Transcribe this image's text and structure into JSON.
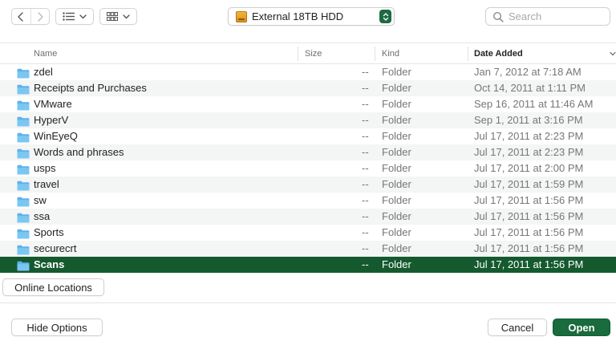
{
  "toolbar": {
    "location_label": "External 18TB HDD",
    "search_placeholder": "Search"
  },
  "columns": {
    "name": "Name",
    "size": "Size",
    "kind": "Kind",
    "date_added": "Date Added"
  },
  "files": [
    {
      "name": "zdel",
      "size": "--",
      "kind": "Folder",
      "date": "Jan 7, 2012 at 7:18 AM"
    },
    {
      "name": "Receipts and Purchases",
      "size": "--",
      "kind": "Folder",
      "date": "Oct 14, 2011 at 1:11 PM"
    },
    {
      "name": "VMware",
      "size": "--",
      "kind": "Folder",
      "date": "Sep 16, 2011 at 11:46 AM"
    },
    {
      "name": "HyperV",
      "size": "--",
      "kind": "Folder",
      "date": "Sep 1, 2011 at 3:16 PM"
    },
    {
      "name": "WinEyeQ",
      "size": "--",
      "kind": "Folder",
      "date": "Jul 17, 2011 at 2:23 PM"
    },
    {
      "name": "Words and phrases",
      "size": "--",
      "kind": "Folder",
      "date": "Jul 17, 2011 at 2:23 PM"
    },
    {
      "name": "usps",
      "size": "--",
      "kind": "Folder",
      "date": "Jul 17, 2011 at 2:00 PM"
    },
    {
      "name": "travel",
      "size": "--",
      "kind": "Folder",
      "date": "Jul 17, 2011 at 1:59 PM"
    },
    {
      "name": "sw",
      "size": "--",
      "kind": "Folder",
      "date": "Jul 17, 2011 at 1:56 PM"
    },
    {
      "name": "ssa",
      "size": "--",
      "kind": "Folder",
      "date": "Jul 17, 2011 at 1:56 PM"
    },
    {
      "name": "Sports",
      "size": "--",
      "kind": "Folder",
      "date": "Jul 17, 2011 at 1:56 PM"
    },
    {
      "name": "securecrt",
      "size": "--",
      "kind": "Folder",
      "date": "Jul 17, 2011 at 1:56 PM"
    },
    {
      "name": "Scans",
      "size": "--",
      "kind": "Folder",
      "date": "Jul 17, 2011 at 1:56 PM"
    }
  ],
  "selected_index": 12,
  "buttons": {
    "online_locations": "Online Locations",
    "hide_options": "Hide Options",
    "cancel": "Cancel",
    "open": "Open"
  },
  "colors": {
    "accent": "#1a6b3d",
    "selection": "#155a2f",
    "folder": "#5cb3ec"
  },
  "icons": {
    "back": "chevron-left-icon",
    "forward": "chevron-right-icon",
    "list_view": "list-view-icon",
    "grid_view": "grid-view-icon",
    "search": "search-icon",
    "folder": "folder-icon",
    "drive": "external-drive-icon"
  }
}
